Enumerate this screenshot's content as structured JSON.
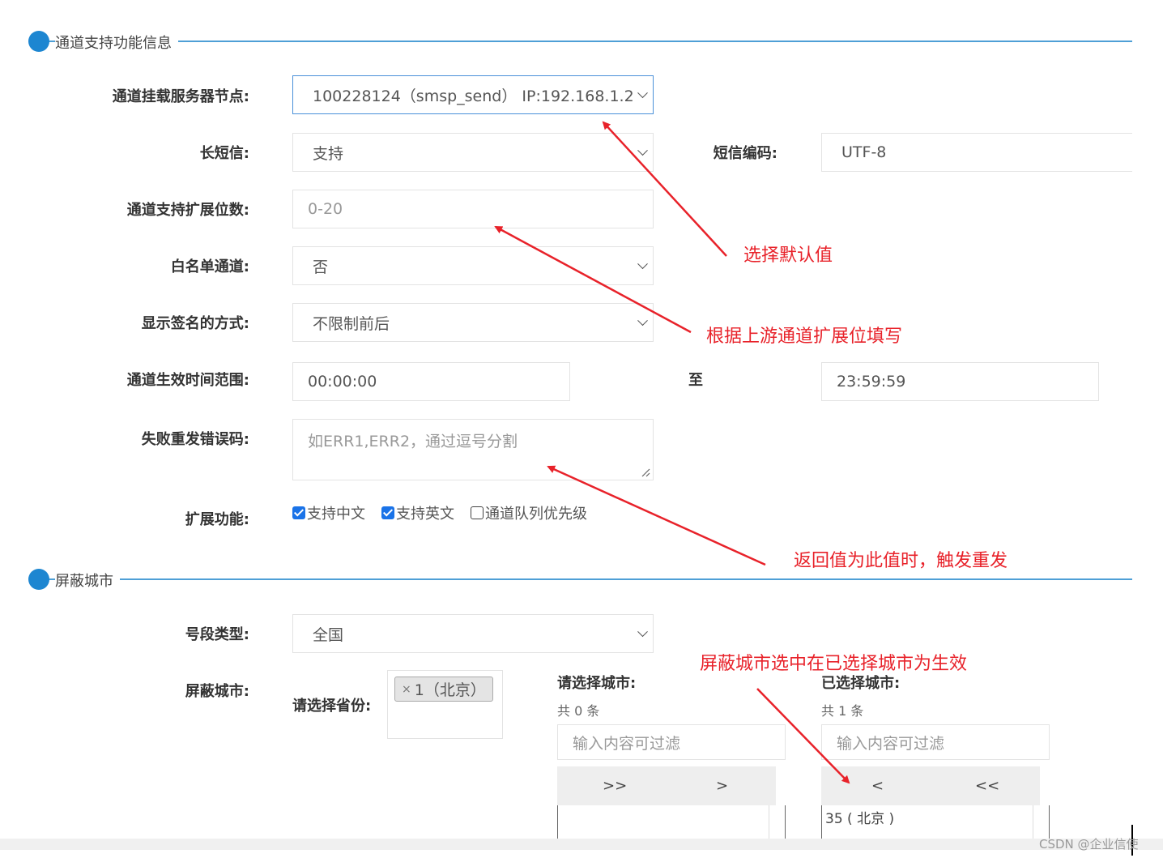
{
  "section1": {
    "title": "通道支持功能信息"
  },
  "section2": {
    "title": "屏蔽城市"
  },
  "form": {
    "server_node": {
      "label": "通道挂载服务器节点:",
      "value": "100228124（smsp_send）  IP:192.168.1.2"
    },
    "long_sms": {
      "label": "长短信:",
      "value": "支持"
    },
    "sms_encoding": {
      "label": "短信编码:",
      "value": "UTF-8"
    },
    "ext_digits": {
      "label": "通道支持扩展位数:",
      "placeholder": "0-20"
    },
    "whitelist": {
      "label": "白名单通道:",
      "value": "否"
    },
    "signature_mode": {
      "label": "显示签名的方式:",
      "value": "不限制前后"
    },
    "effective_time": {
      "label": "通道生效时间范围:",
      "start": "00:00:00",
      "to_label": "至",
      "end": "23:59:59"
    },
    "retry_codes": {
      "label": "失败重发错误码:",
      "placeholder": "如ERR1,ERR2，通过逗号分割"
    },
    "ext_features": {
      "label": "扩展功能:",
      "options": [
        {
          "label": "支持中文",
          "checked": true
        },
        {
          "label": "支持英文",
          "checked": true
        },
        {
          "label": "通道队列优先级",
          "checked": false
        }
      ]
    },
    "segment_type": {
      "label": "号段类型:",
      "value": "全国"
    },
    "blocked_city": {
      "label": "屏蔽城市:"
    },
    "province": {
      "label": "请选择省份:",
      "tag_x": "×",
      "tag": "1（北京）"
    },
    "available": {
      "title": "请选择城市:",
      "count": "共 0 条",
      "filter_placeholder": "输入内容可过滤",
      "btn_all": ">>",
      "btn_one": ">"
    },
    "selected": {
      "title": "已选择城市:",
      "count": "共 1 条",
      "filter_placeholder": "输入内容可过滤",
      "btn_one": "<",
      "btn_all": "<<",
      "items": [
        "35 ( 北京 )"
      ]
    }
  },
  "annotations": {
    "a1": "选择默认值",
    "a2": "根据上游通道扩展位填写",
    "a3": "返回值为此值时，触发重发",
    "a4": "屏蔽城市选中在已选择城市为生效"
  },
  "watermark": "CSDN @企业信使",
  "colors": {
    "accent": "#1d86d1",
    "annotation": "#e8222a",
    "checkbox": "#1a73e8"
  }
}
